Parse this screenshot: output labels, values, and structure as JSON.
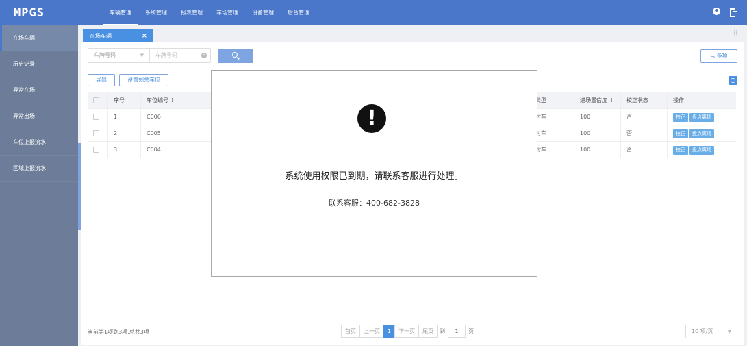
{
  "brand": "MPGS",
  "top_nav": [
    "车辆管理",
    "系统管理",
    "报表管理",
    "车场管理",
    "设备管理",
    "后台管理"
  ],
  "sidebar": {
    "items": [
      {
        "label": "在场车辆"
      },
      {
        "label": "历史记录"
      },
      {
        "label": "异常在场"
      },
      {
        "label": "异常出场"
      },
      {
        "label": "车位上报流水"
      },
      {
        "label": "区域上报流水"
      }
    ]
  },
  "tab": {
    "label": "在场车辆",
    "close": "×"
  },
  "search": {
    "select_label": "车牌号码",
    "caret": "▼",
    "placeholder": "车牌号码",
    "multi_label": "≒ 多项"
  },
  "toolbar": {
    "export": "导出",
    "set_remaining": "设置剩余车位"
  },
  "table": {
    "headers": [
      "序号",
      "车位编号 ⇕",
      "",
      "类型",
      "进场置信度 ⇕",
      "校正状态",
      "操作"
    ],
    "rows": [
      {
        "no": "1",
        "space": "C006",
        "type": "时车",
        "confidence": "100",
        "status": "否"
      },
      {
        "no": "2",
        "space": "C005",
        "type": "时车",
        "confidence": "100",
        "status": "否"
      },
      {
        "no": "3",
        "space": "C004",
        "type": "时车",
        "confidence": "100",
        "status": "否"
      }
    ],
    "action_correct": "校正",
    "action_exit": "盘点离场"
  },
  "footer": {
    "info": "当前第1项到3项,总共3项",
    "first": "首页",
    "prev": "上一页",
    "current_page": "1",
    "next": "下一页",
    "last": "尾页",
    "goto_prefix": "到",
    "goto_value": "1",
    "goto_suffix": "页",
    "page_size": "10 项/页"
  },
  "modal": {
    "icon": "!",
    "message": "系统使用权限已到期，请联系客服进行处理。",
    "contact": "联系客服：400-682-3828"
  },
  "colors": {
    "primary": "#4a77c9",
    "accent": "#4a90e2",
    "sidebar": "#6d7d99"
  }
}
